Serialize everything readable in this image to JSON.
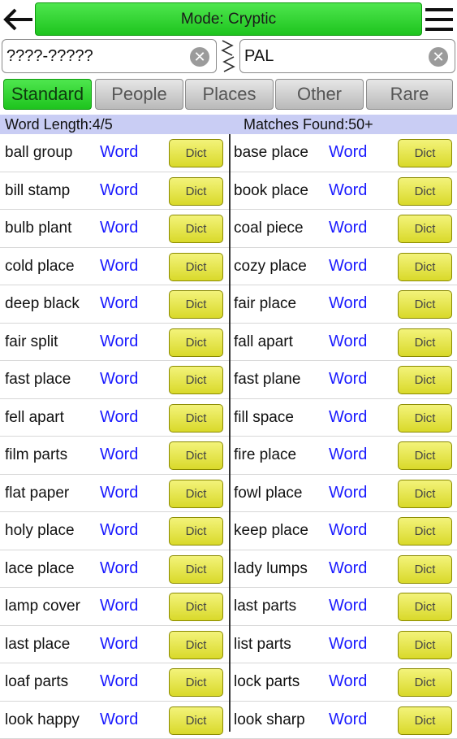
{
  "header": {
    "mode_label": "Mode: Cryptic"
  },
  "search": {
    "pattern_value": "????-?????",
    "letters_value": "PAL",
    "clear_symbol": "✕"
  },
  "tabs": [
    {
      "label": "Standard",
      "active": true
    },
    {
      "label": "People",
      "active": false
    },
    {
      "label": "Places",
      "active": false
    },
    {
      "label": "Other",
      "active": false
    },
    {
      "label": "Rare",
      "active": false
    }
  ],
  "info": {
    "word_length": "Word Length:4/5",
    "matches_found": "Matches Found:50+"
  },
  "result_labels": {
    "word": "Word",
    "dict": "Dict"
  },
  "results": [
    [
      "ball group",
      "base place"
    ],
    [
      "bill stamp",
      "book place"
    ],
    [
      "bulb plant",
      "coal piece"
    ],
    [
      "cold place",
      "cozy place"
    ],
    [
      "deep black",
      "fair place"
    ],
    [
      "fair split",
      "fall apart"
    ],
    [
      "fast place",
      "fast plane"
    ],
    [
      "fell apart",
      "fill space"
    ],
    [
      "film parts",
      "fire place"
    ],
    [
      "flat paper",
      "fowl place"
    ],
    [
      "holy place",
      "keep place"
    ],
    [
      "lace place",
      "lady lumps"
    ],
    [
      "lamp cover",
      "last parts"
    ],
    [
      "last place",
      "list parts"
    ],
    [
      "loaf parts",
      "lock parts"
    ],
    [
      "look happy",
      "look sharp"
    ]
  ],
  "colors": {
    "accent_green": "#1ec41e",
    "link_blue": "#1a1aff",
    "dict_yellow": "#d9d92a",
    "info_bar": "#c9cdf4"
  },
  "icons": {
    "back": "back-arrow-icon",
    "menu": "hamburger-menu-icon",
    "swap": "swap-arrows-icon",
    "clear": "clear-icon"
  }
}
